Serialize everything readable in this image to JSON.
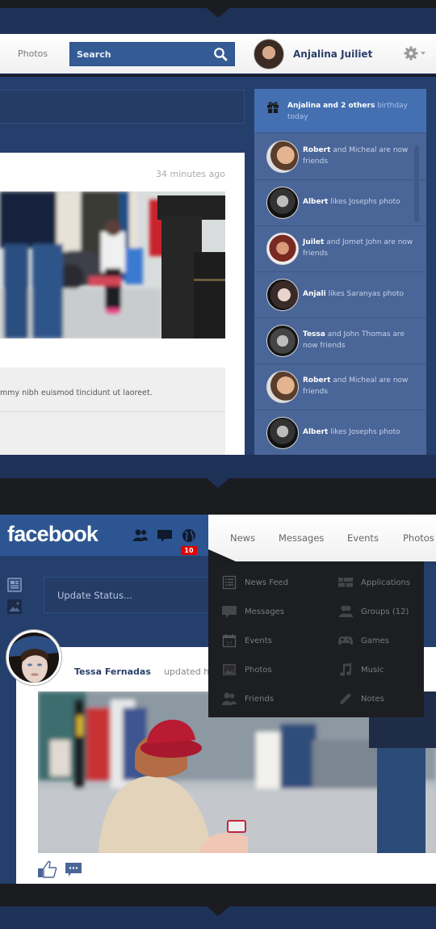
{
  "top_header": {
    "nav_photos": "Photos",
    "search_placeholder": "Search",
    "user_name": "Anjalina Juiliet"
  },
  "feed_post": {
    "time": "34 minutes ago",
    "text": "mmy nibh euismod tincidunt ut laoreet."
  },
  "ticker": {
    "birthday": {
      "name": "Anjalina",
      "others": "and 2 others",
      "suffix": "birthday today"
    },
    "items": [
      {
        "name": "Robert",
        "text": "and Micheal are now friends"
      },
      {
        "name": "Albert",
        "text": "likes Josephs photo"
      },
      {
        "name": "Juilet",
        "text": "and Jomet John are now friends"
      },
      {
        "name": "Anjali",
        "text": "likes Saranyas photo"
      },
      {
        "name": "Tessa",
        "text": "and John Thomas are now friends"
      },
      {
        "name": "Robert",
        "text": "and Micheal are now friends"
      },
      {
        "name": "Albert",
        "text": "likes Josephs photo"
      }
    ]
  },
  "fb_header": {
    "logo": "facebook",
    "notification_count": "10",
    "icons": [
      "friends-icon",
      "messages-icon",
      "globe-icon"
    ]
  },
  "tabs": [
    "News",
    "Messages",
    "Events",
    "Photos"
  ],
  "dropdown": {
    "left": [
      {
        "label": "News Feed",
        "icon": "news-feed-icon"
      },
      {
        "label": "Messages",
        "icon": "messages-icon"
      },
      {
        "label": "Events",
        "icon": "calendar-icon"
      },
      {
        "label": "Photos",
        "icon": "photo-icon"
      },
      {
        "label": "Friends",
        "icon": "friends-icon"
      }
    ],
    "right": [
      {
        "label": "Applications",
        "icon": "applications-icon"
      },
      {
        "label": "Groups (12)",
        "icon": "groups-icon"
      },
      {
        "label": "Games",
        "icon": "gamepad-icon"
      },
      {
        "label": "Music",
        "icon": "music-icon"
      },
      {
        "label": "Notes",
        "icon": "pencil-icon"
      }
    ],
    "calendar_day": "17"
  },
  "status": {
    "placeholder": "Update Status..."
  },
  "post2": {
    "author": "Tessa Fernadas",
    "action": "updated h"
  },
  "colors": {
    "navy": "#1e3157",
    "panel_blue": "#253f6c",
    "ticker_blue": "#4a6597",
    "birthday_blue": "#4470b1",
    "dark": "#1b1c20",
    "fb_blue": "#2d5592",
    "badge_red": "#e40000"
  }
}
